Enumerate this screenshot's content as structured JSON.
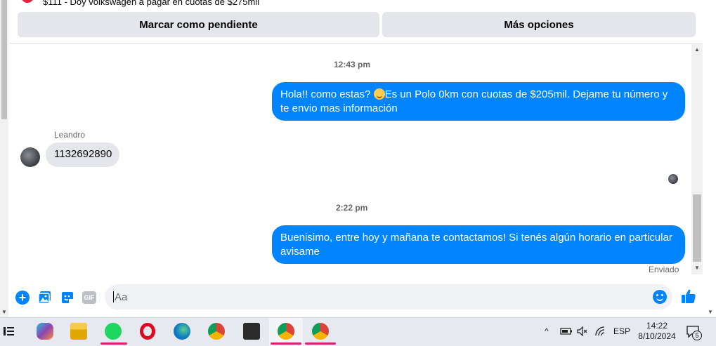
{
  "header": {
    "item_text": "$111 - Doy volkswagen a pagar en cuotas de $275mil",
    "mark_pending_label": "Marcar como pendiente",
    "more_options_label": "Más opciones"
  },
  "chat": {
    "messages": [
      {
        "time": "12:43 pm",
        "text_before_emoji": "Hola!! como estas? ",
        "text_after_emoji": "Es un Polo 0km con cuotas de $205mil. Dejame tu número y te envio mas información",
        "emoji": "smiling-face-icon"
      },
      {
        "sender": "Leandro",
        "text": "1132692890"
      },
      {
        "time": "2:22 pm",
        "text": "Buenisimo, entre hoy y mañana te contactamos! Si tenés algún horario en particular avisame",
        "status": "Enviado"
      }
    ]
  },
  "composer": {
    "placeholder": "Aa",
    "gif_label": "GIF",
    "plus_symbol": "+"
  },
  "taskbar": {
    "language": "ESP",
    "time": "14:22",
    "date": "8/10/2024",
    "notification_count": "5",
    "apps": [
      "task-view-icon",
      "copilot-icon",
      "file-explorer-icon",
      "spotify-icon",
      "opera-icon",
      "edge-icon",
      "chrome-icon",
      "sticky-notes-icon",
      "chrome-profile-y-icon",
      "chrome-profile-r-icon"
    ]
  },
  "colors": {
    "messenger_blue": "#0084ff",
    "incoming_bubble": "#e4e6eb",
    "button_gray": "#e4e6eb",
    "active_indicator": "#d0246f"
  }
}
